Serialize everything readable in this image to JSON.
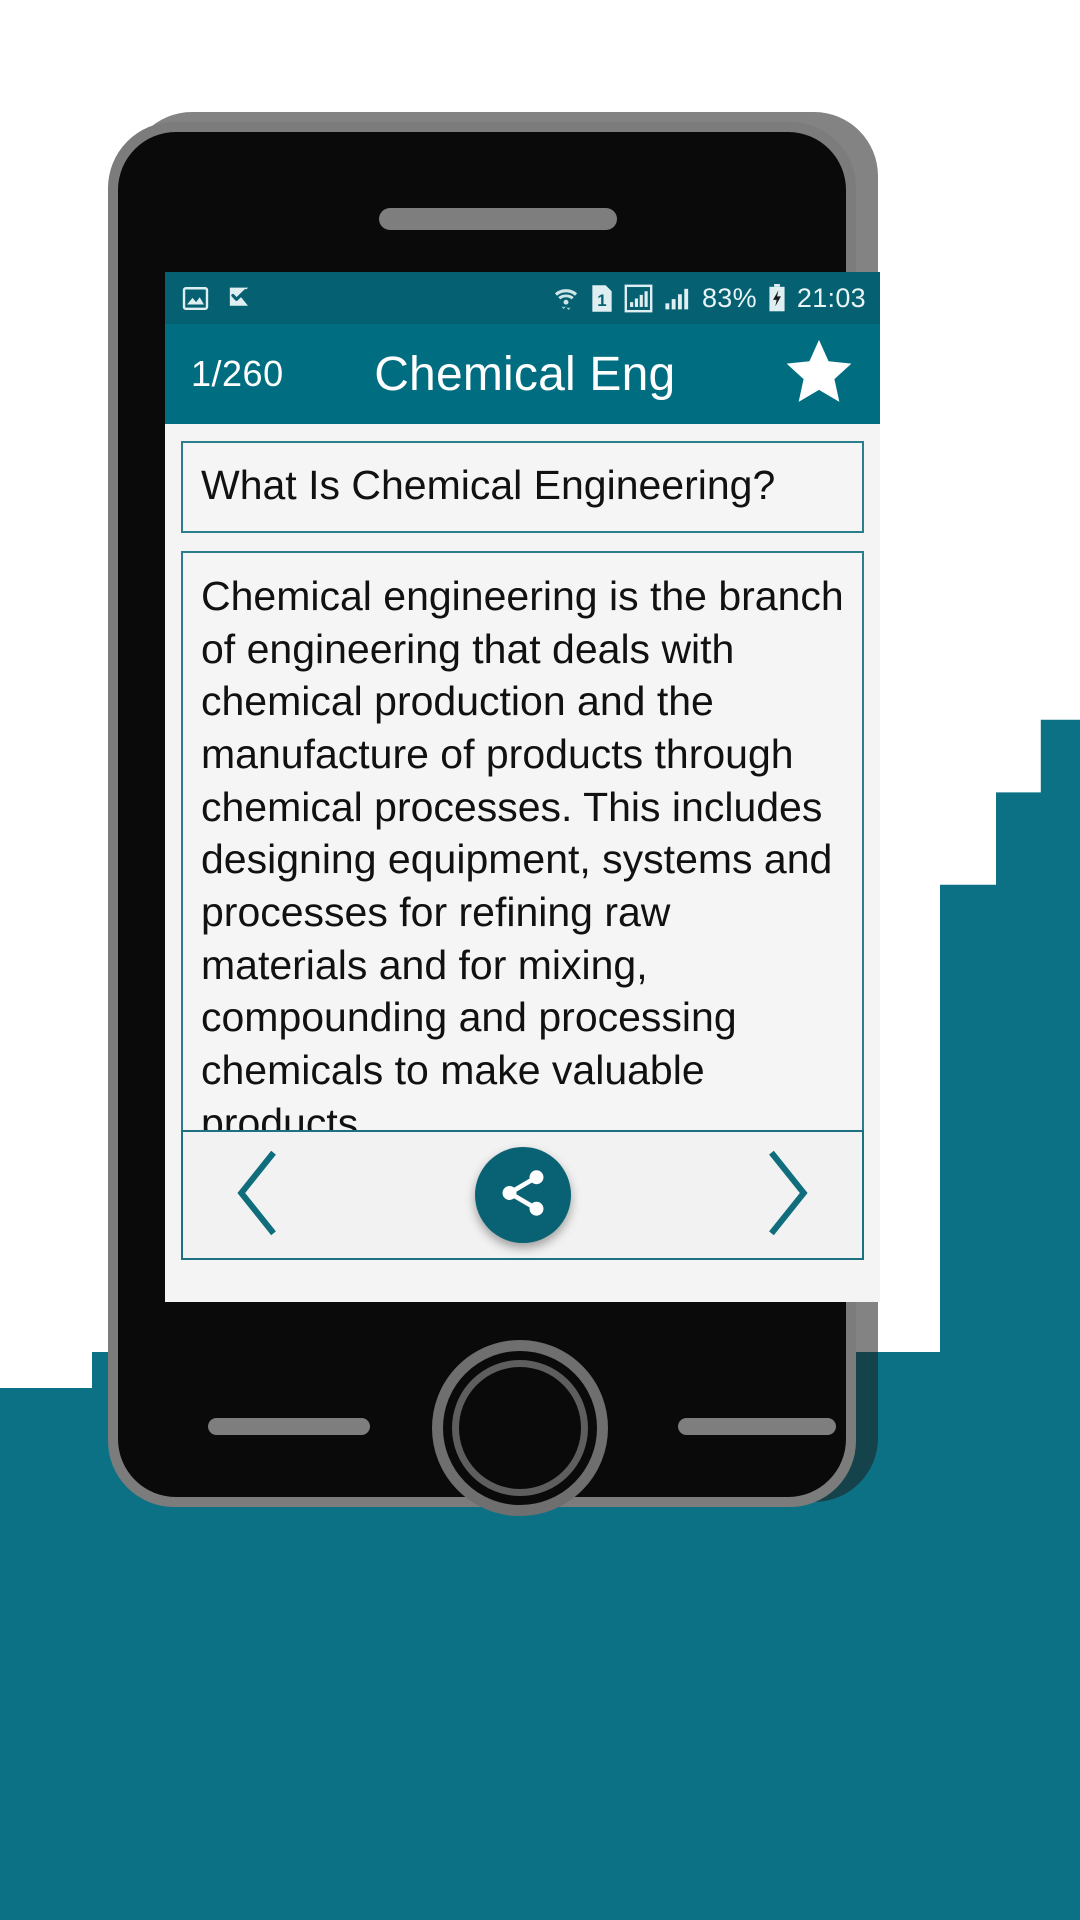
{
  "statusbar": {
    "icons_left": [
      "image-icon",
      "checkmark-flag-icon"
    ],
    "icons_right": [
      "wifi-icon",
      "sim-1-icon",
      "signal-boxed-icon",
      "signal-icon",
      "battery-charging-icon"
    ],
    "sim_label": "1",
    "battery_percent": "83%",
    "time": "21:03"
  },
  "appbar": {
    "counter": "1/260",
    "title": "Chemical Eng",
    "favorite_icon": "star-filled-icon"
  },
  "content": {
    "question": "What Is Chemical Engineering?",
    "answer": "Chemical engineering is the branch of engineering that deals with chemical production and the manufacture of products through chemical processes. This includes designing equipment, systems and processes for refining raw materials and for mixing, compounding and processing chemicals to make valuable products"
  },
  "bottom_nav": {
    "previous_icon": "chevron-left-icon",
    "share_icon": "share-icon",
    "next_icon": "chevron-right-icon"
  },
  "colors": {
    "statusbar": "#056071",
    "appbar": "#006e80",
    "accent": "#0d7186",
    "card_border": "#2b7f8c",
    "screen_bg": "#f4f4f4"
  }
}
